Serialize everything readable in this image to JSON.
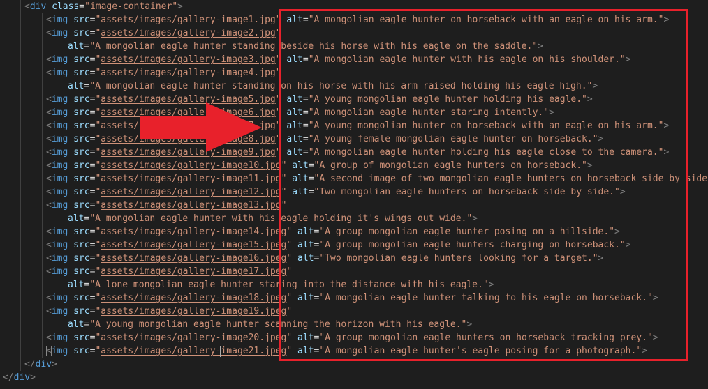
{
  "editor": {
    "lines": [
      {
        "indent": 1,
        "kind": "open-div",
        "class": "image-container"
      },
      {
        "indent": 2,
        "kind": "img",
        "src": "assets/images/gallery-image1.jpg",
        "alt": "A mongolian eagle hunter on horseback with an eagle on his arm.",
        "wrap": false
      },
      {
        "indent": 2,
        "kind": "img-src",
        "src": "assets/images/gallery-image2.jpg"
      },
      {
        "indent": 3,
        "kind": "alt",
        "alt": "A mongolian eagle hunter standing beside his horse with his eagle on the saddle."
      },
      {
        "indent": 2,
        "kind": "img",
        "src": "assets/images/gallery-image3.jpg",
        "alt": "A mongolian eagle hunter with his eagle on his shoulder.",
        "wrap": false
      },
      {
        "indent": 2,
        "kind": "img-src",
        "src": "assets/images/gallery-image4.jpg"
      },
      {
        "indent": 3,
        "kind": "alt",
        "alt": "A mongolian eagle hunter standing on his horse with his arm raised holding his eagle high."
      },
      {
        "indent": 2,
        "kind": "img",
        "src": "assets/images/gallery-image5.jpg",
        "alt": "A young mongolian eagle hunter holding his eagle.",
        "wrap": false
      },
      {
        "indent": 2,
        "kind": "img",
        "src": "assets/images/gallery-image6.jpg",
        "alt": "A mongolian eagle hunter staring intently.",
        "wrap": false
      },
      {
        "indent": 2,
        "kind": "img",
        "src": "assets/images/gallery-image7.jpg",
        "alt": "A young mongolian hunter on horseback with an eagle on his arm.",
        "wrap": false
      },
      {
        "indent": 2,
        "kind": "img",
        "src": "assets/images/gallery-image8.jpg",
        "alt": "A young female mongolian eagle hunter on horseback.",
        "wrap": false
      },
      {
        "indent": 2,
        "kind": "img",
        "src": "assets/images/gallery-image9.jpg",
        "alt": "A mongolian eagle hunter holding his eagle close to the camera.",
        "wrap": false
      },
      {
        "indent": 2,
        "kind": "img",
        "src": "assets/images/gallery-image10.jpg",
        "alt": "A group of mongolian eagle hunters on horseback.",
        "wrap": false
      },
      {
        "indent": 2,
        "kind": "img",
        "src": "assets/images/gallery-image11.jpg",
        "alt": "A second image of two mongolian eagle hunters on horseback side by side.",
        "wrap": false
      },
      {
        "indent": 2,
        "kind": "img",
        "src": "assets/images/gallery-image12.jpg",
        "alt": "Two mongolian eagle hunters on horseback side by side.",
        "wrap": false
      },
      {
        "indent": 2,
        "kind": "img-src",
        "src": "assets/images/gallery-image13.jpg"
      },
      {
        "indent": 3,
        "kind": "alt",
        "alt": "A mongolian eagle hunter with his eagle holding it's wings out wide."
      },
      {
        "indent": 2,
        "kind": "img",
        "src": "assets/images/gallery-image14.jpeg",
        "alt": "A group mongolian eagle hunter posing on a hillside.",
        "wrap": false
      },
      {
        "indent": 2,
        "kind": "img",
        "src": "assets/images/gallery-image15.jpeg",
        "alt": "A group mongolian eagle hunters charging on horseback.",
        "wrap": false
      },
      {
        "indent": 2,
        "kind": "img",
        "src": "assets/images/gallery-image16.jpeg",
        "alt": "Two mongolian eagle hunters looking for a target.",
        "wrap": false
      },
      {
        "indent": 2,
        "kind": "img-src",
        "src": "assets/images/gallery-image17.jpeg"
      },
      {
        "indent": 3,
        "kind": "alt",
        "alt": "A lone mongolian eagle hunter staring into the distance with his eagle."
      },
      {
        "indent": 2,
        "kind": "img",
        "src": "assets/images/gallery-image18.jpeg",
        "alt": "A mongolian eagle hunter talking to his eagle on horseback.",
        "wrap": false
      },
      {
        "indent": 2,
        "kind": "img-src",
        "src": "assets/images/gallery-image19.jpeg"
      },
      {
        "indent": 3,
        "kind": "alt",
        "alt": "A young mongolian eagle hunter scanning the horizon with his eagle."
      },
      {
        "indent": 2,
        "kind": "img",
        "src": "assets/images/gallery-image20.jpeg",
        "alt": "A group mongolian eagle hunters on horseback tracking prey.",
        "wrap": false
      },
      {
        "indent": 2,
        "kind": "img",
        "src": "assets/images/gallery-image21.jpeg",
        "alt": "A mongolian eagle hunter's eagle posing for a photograph.",
        "wrap": false,
        "cursor_after": "gallery-",
        "bracket_highlight": true
      },
      {
        "indent": 1,
        "kind": "close-div"
      },
      {
        "indent": 0,
        "kind": "close-div"
      }
    ]
  },
  "annotations": {
    "box_color": "#e8212b",
    "arrow_color": "#e8212b",
    "arrow_direction": "right"
  },
  "syntax_colors": {
    "tag": "#569cd6",
    "attr": "#9cdcfe",
    "string": "#ce9178",
    "punct": "#808080",
    "text": "#d4d4d4",
    "background": "#1e1e1e"
  }
}
